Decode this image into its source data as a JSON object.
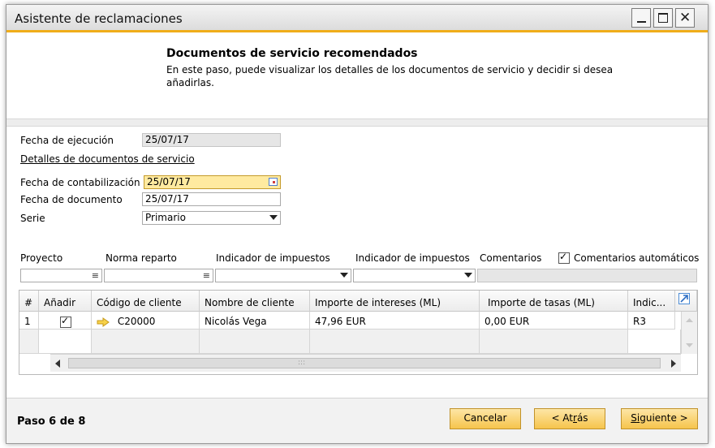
{
  "window": {
    "title": "Asistente de reclamaciones"
  },
  "header": {
    "title": "Documentos de servicio recomendados",
    "description": "En este paso, puede visualizar los detalles de los documentos de servicio y decidir si desea añadirlas."
  },
  "form": {
    "fecha_ejecucion_label": "Fecha de ejecución",
    "fecha_ejecucion_value": "25/07/17",
    "detalles_link": "Detalles de documentos de servicio",
    "fecha_contabilizacion_label": "Fecha de contabilización",
    "fecha_contabilizacion_value": "25/07/17",
    "fecha_documento_label": "Fecha de documento",
    "fecha_documento_value": "25/07/17",
    "serie_label": "Serie",
    "serie_value": "Primario"
  },
  "filters": {
    "proyecto_label": "Proyecto",
    "norma_label": "Norma reparto",
    "indicador1_label": "Indicador de impuestos",
    "indicador2_label": "Indicador de impuestos",
    "comentarios_label": "Comentarios",
    "comentarios_auto_label": "Comentarios automáticos",
    "comentarios_auto_checked": true
  },
  "table": {
    "columns": [
      "#",
      "Añadir",
      "Código de cliente",
      "Nombre de cliente",
      "Importe de intereses (ML)",
      "Importe de tasas (ML)",
      "Indic..."
    ],
    "rows": [
      {
        "num": "1",
        "anadir": true,
        "codigo": "C20000",
        "nombre": "Nicolás Vega",
        "intereses": "47,96 EUR",
        "tasas": "0,00 EUR",
        "indic": "R3"
      }
    ]
  },
  "footer": {
    "step": "Paso 6 de 8",
    "cancel": "Cancelar",
    "back_pre": "< At",
    "back_key": "r",
    "back_post": "ás",
    "next_pre": "S",
    "next_key": "i",
    "next_post": "guiente >"
  },
  "colors": {
    "accent": "#f0ad1a",
    "button": "#f6c44c",
    "highlight": "#ffeaa0"
  }
}
